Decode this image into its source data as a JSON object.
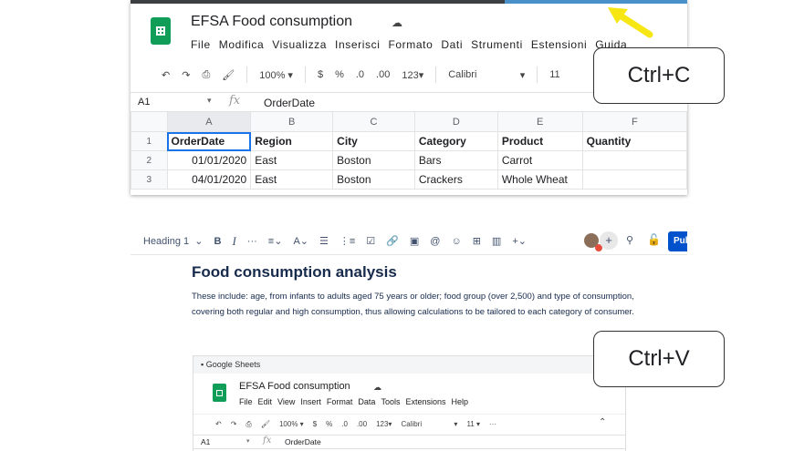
{
  "sheets": {
    "title": "EFSA Food consumption",
    "cloud_icon": "cloud-check-icon",
    "menu": [
      "File",
      "Modifica",
      "Visualizza",
      "Inserisci",
      "Formato",
      "Dati",
      "Strumenti",
      "Estensioni",
      "Guida"
    ],
    "toolbar": {
      "zoom": "100%",
      "currency": "$",
      "percent": "%",
      "dec_decrease": ".0",
      "dec_increase": ".00",
      "format": "123",
      "font": "Calibri",
      "size": "11"
    },
    "cell_ref": "A1",
    "fx": "fx",
    "formula_value": "OrderDate",
    "columns": [
      "A",
      "B",
      "C",
      "D",
      "E",
      "F"
    ],
    "rows": [
      {
        "num": "1",
        "cells": [
          "OrderDate",
          "Region",
          "City",
          "Category",
          "Product",
          "Quantity"
        ]
      },
      {
        "num": "2",
        "cells": [
          "01/01/2020",
          "East",
          "Boston",
          "Bars",
          "Carrot",
          ""
        ]
      },
      {
        "num": "3",
        "cells": [
          "04/01/2020",
          "East",
          "Boston",
          "Crackers",
          "Whole Wheat",
          ""
        ]
      }
    ]
  },
  "callouts": {
    "copy": "Ctrl+C",
    "paste": "Ctrl+V"
  },
  "confluence": {
    "toolbar": {
      "style": "Heading 1",
      "bold": "B",
      "italic": "I",
      "more": "···",
      "publish": "Pub"
    },
    "heading": "Food consumption analysis",
    "body": "These include: age, from infants to adults aged 75 years or older; food group (over 2,500) and type of consumption, covering both regular and high consumption, thus allowing calculations to be tailored to each category of consumer.",
    "embed": {
      "source": "Google Sheets",
      "title": "EFSA Food consumption",
      "menu": [
        "File",
        "Edit",
        "View",
        "Insert",
        "Format",
        "Data",
        "Tools",
        "Extensions",
        "Help"
      ],
      "zoom": "100%",
      "currency": "$",
      "percent": "%",
      "dec_decrease": ".0",
      "dec_increase": ".00",
      "format": "123",
      "font": "Calibri",
      "size": "11",
      "more": "···",
      "cell_ref": "A1",
      "fx": "fx",
      "formula_value": "OrderDate"
    }
  },
  "colors": {
    "sheets_green": "#0f9d58",
    "selection_blue": "#1a73e8",
    "arrow_yellow": "#f5e614",
    "publish_blue": "#0052cc"
  }
}
